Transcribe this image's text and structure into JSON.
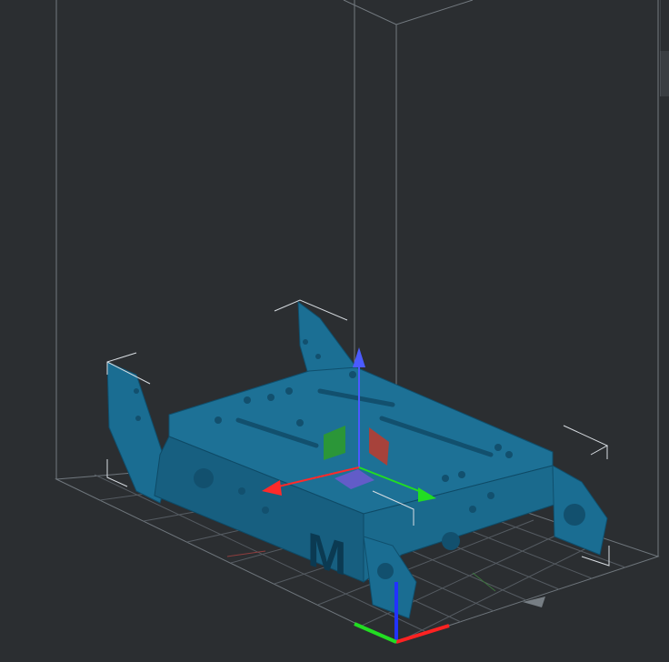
{
  "viewport": {
    "background": "#2b2e31",
    "model_color": "#1a6d92",
    "model_edge_color": "#0f4f6d",
    "grid_color": "#5a6168",
    "build_volume_color": "#8c949b"
  },
  "model": {
    "engraved_letter": "M"
  },
  "gizmo": {
    "x_axis_color": "#ff2a2a",
    "y_axis_color": "#22dd22",
    "z_axis_color": "#4b5bff",
    "plane_xy_color": "#6a5acd",
    "plane_xz_color": "#c0392b",
    "plane_yz_color": "#2e9a2e"
  },
  "origin_axes": {
    "x_color": "#ff2222",
    "y_color": "#22dd22",
    "z_color": "#2233ff"
  },
  "side_panel": {
    "icon": "panel-collapse-icon"
  }
}
